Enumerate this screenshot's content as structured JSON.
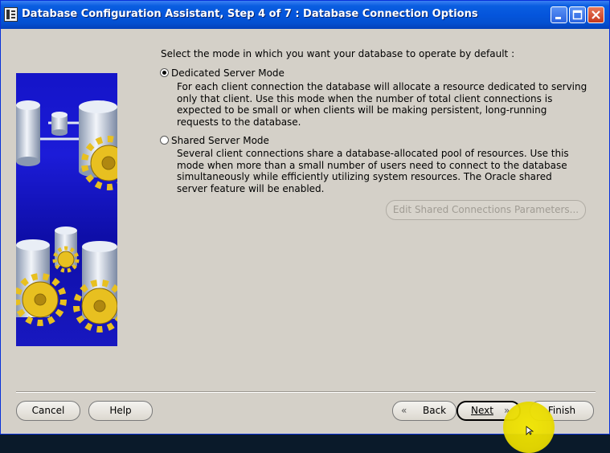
{
  "window": {
    "title": "Database Configuration Assistant, Step 4 of 7 : Database Connection Options"
  },
  "main": {
    "prompt": "Select the mode in which you want your database to operate by default :",
    "options": [
      {
        "label": "Dedicated Server Mode",
        "selected": true,
        "description": "For each client connection the database will allocate a resource dedicated to serving\nonly that client.  Use this mode when the number of total client connections is\nexpected to be small or when clients will be making persistent, long-running\nrequests to the database."
      },
      {
        "label": "Shared Server Mode",
        "selected": false,
        "description": "Several client connections share a database-allocated pool of resources.  Use this\nmode when more than a small number of users need to connect to the database\nsimultaneously while efficiently utilizing system resources.  The Oracle shared\nserver feature will be enabled."
      }
    ],
    "edit_shared_button": "Edit Shared Connections Parameters..."
  },
  "footer": {
    "cancel": "Cancel",
    "help": "Help",
    "back": "Back",
    "next": "Next",
    "finish": "Finish"
  },
  "icons": {
    "back_arrow": "«",
    "next_arrow": "»"
  },
  "colors": {
    "title_bar": "#0455dc",
    "panel_blue": "#1414c8",
    "gear_gold": "#e8c020",
    "background": "#d4d0c8"
  }
}
